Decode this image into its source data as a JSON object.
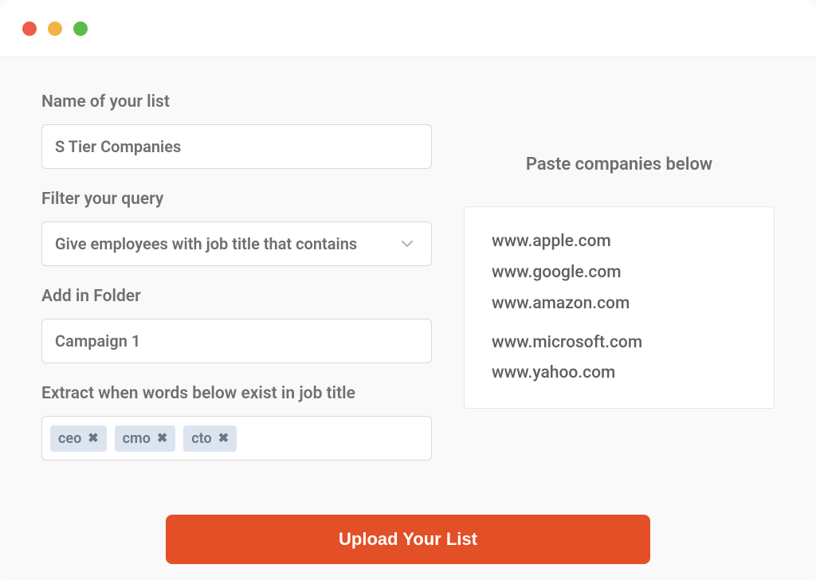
{
  "form": {
    "name_label": "Name of your list",
    "name_value": "S Tier Companies",
    "filter_label": "Filter your query",
    "filter_value": "Give employees with job title that contains",
    "folder_label": "Add in Folder",
    "folder_value": "Campaign 1",
    "extract_label": "Extract when words below exist in job title",
    "tags": [
      "ceo",
      "cmo",
      "cto"
    ]
  },
  "paste": {
    "label": "Paste companies below",
    "lines": [
      "www.apple.com",
      "www.google.com",
      "www.amazon.com",
      "www.microsoft.com",
      "www.yahoo.com"
    ]
  },
  "actions": {
    "upload_label": "Upload Your List"
  },
  "colors": {
    "accent": "#e34f26"
  }
}
